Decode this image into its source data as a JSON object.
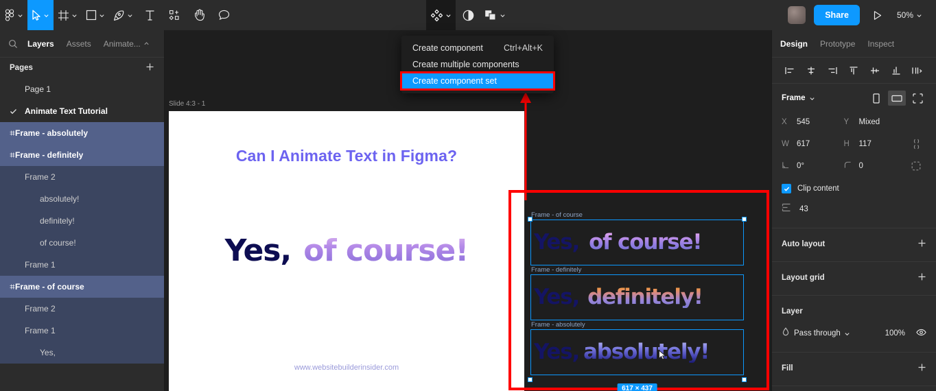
{
  "toolbar": {
    "left_tools": [
      {
        "name": "figma-menu-icon",
        "label": "Figma menu",
        "caret": true,
        "active": false
      },
      {
        "name": "move-tool-icon",
        "label": "Move",
        "caret": true,
        "active": true
      },
      {
        "name": "frame-tool-icon",
        "label": "Frame",
        "caret": true,
        "active": false
      },
      {
        "name": "shape-tool-icon",
        "label": "Shape",
        "caret": true,
        "active": false
      },
      {
        "name": "pen-tool-icon",
        "label": "Pen",
        "caret": true,
        "active": false
      },
      {
        "name": "text-tool-icon",
        "label": "Text",
        "caret": false,
        "active": false
      },
      {
        "name": "resources-icon",
        "label": "Resources",
        "caret": false,
        "active": false
      },
      {
        "name": "hand-tool-icon",
        "label": "Hand",
        "caret": false,
        "active": false
      },
      {
        "name": "comment-tool-icon",
        "label": "Comment",
        "caret": false,
        "active": false
      }
    ],
    "center_tools": [
      {
        "name": "component-icon",
        "label": "Create component",
        "caret": true,
        "active": true
      },
      {
        "name": "mask-icon",
        "label": "Use as mask",
        "caret": false,
        "active": false
      },
      {
        "name": "boolean-icon",
        "label": "Boolean groups",
        "caret": true,
        "active": false
      }
    ],
    "share_label": "Share",
    "present_icon": "play-icon",
    "zoom_label": "50%"
  },
  "context_menu": {
    "items": [
      {
        "label": "Create component",
        "shortcut": "Ctrl+Alt+K",
        "selected": false
      },
      {
        "label": "Create multiple components",
        "shortcut": "",
        "selected": false
      },
      {
        "label": "Create component set",
        "shortcut": "",
        "selected": true
      }
    ]
  },
  "sidebar": {
    "tabs": [
      {
        "label": "Layers",
        "active": true
      },
      {
        "label": "Assets",
        "active": false
      },
      {
        "label": "Animate...",
        "active": false,
        "caret": true
      }
    ],
    "pages_header": "Pages",
    "pages": [
      {
        "label": "Page 1",
        "current": false
      },
      {
        "label": "Animate Text Tutorial",
        "current": true
      }
    ],
    "layers": [
      {
        "label": "Frame - absolutely",
        "icon": "frame-icon",
        "depth": 0,
        "selected": true,
        "bold": true
      },
      {
        "label": "Frame - definitely",
        "icon": "frame-icon",
        "depth": 0,
        "selected": true,
        "bold": true
      },
      {
        "label": "Frame 2",
        "icon": "frame-icon",
        "depth": 1,
        "selected": false,
        "bold": false
      },
      {
        "label": "absolutely!",
        "icon": "text-icon",
        "depth": 2,
        "selected": false,
        "bold": false
      },
      {
        "label": "definitely!",
        "icon": "text-icon",
        "depth": 2,
        "selected": false,
        "bold": false
      },
      {
        "label": "of course!",
        "icon": "text-icon",
        "depth": 2,
        "selected": false,
        "bold": false
      },
      {
        "label": "Frame 1",
        "icon": "frame-icon",
        "depth": 1,
        "selected": false,
        "bold": false
      },
      {
        "label": "Frame - of course",
        "icon": "frame-icon",
        "depth": 0,
        "selected": true,
        "bold": true
      },
      {
        "label": "Frame 2",
        "icon": "frame-icon",
        "depth": 1,
        "selected": false,
        "bold": false
      },
      {
        "label": "Frame 1",
        "icon": "frame-icon",
        "depth": 1,
        "selected": false,
        "bold": false
      },
      {
        "label": "Yes,",
        "icon": "text-icon",
        "depth": 2,
        "selected": false,
        "bold": false
      }
    ]
  },
  "canvas": {
    "slide_frame_title": "Slide 4:3 - 1",
    "slide": {
      "heading": "Can I Animate Text in Figma?",
      "text_dark": "Yes,",
      "text_gradient": "of course!",
      "url": "www.websitebuilderinsider.com"
    },
    "component_set": {
      "size_badge": "617 × 437",
      "frames": [
        {
          "title": "Frame - of course",
          "yes": "Yes,",
          "word": "of course!",
          "gradient": "g-course"
        },
        {
          "title": "Frame - definitely",
          "yes": "Yes,",
          "word": "definitely!",
          "gradient": "g-def"
        },
        {
          "title": "Frame - absolutely",
          "yes": "Yes,",
          "word": "absolutely!",
          "gradient": "g-abs"
        }
      ]
    }
  },
  "right_panel": {
    "tabs": [
      {
        "label": "Design",
        "active": true
      },
      {
        "label": "Prototype",
        "active": false
      },
      {
        "label": "Inspect",
        "active": false
      }
    ],
    "align_buttons": [
      "align-left-icon",
      "align-horizontal-center-icon",
      "align-right-icon",
      "align-top-icon",
      "align-vertical-center-icon",
      "align-bottom-icon",
      "distribute-icon"
    ],
    "frame_section": {
      "title": "Frame",
      "properties": [
        {
          "key": "X",
          "value": "545"
        },
        {
          "key": "Y",
          "value": "Mixed"
        },
        {
          "key": "W",
          "value": "617"
        },
        {
          "key": "H",
          "value": "117"
        },
        {
          "key": "rotation",
          "value": "0°"
        },
        {
          "key": "corner",
          "value": "0"
        }
      ],
      "clip_content_label": "Clip content",
      "clip_content_checked": true,
      "padding_value": "43"
    },
    "sections": [
      {
        "title": "Auto layout",
        "action": "plus-icon"
      },
      {
        "title": "Layout grid",
        "action": "plus-icon"
      }
    ],
    "layer_section": {
      "title": "Layer",
      "blend_mode": "Pass through",
      "opacity": "100%"
    },
    "fill_section": {
      "title": "Fill",
      "action": "plus-icon"
    }
  },
  "colors": {
    "accent": "#0d99ff",
    "annotation": "#ff0000",
    "panel_bg": "#2c2c2c",
    "canvas_bg": "#1e1e1e",
    "layer_selected": "#53618a"
  }
}
